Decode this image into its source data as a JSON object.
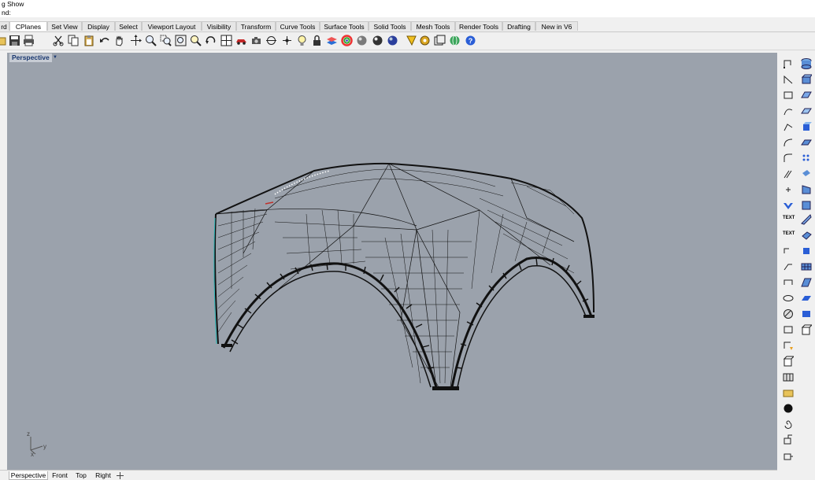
{
  "command_lines": {
    "line1": "g Show",
    "line2": "nd:"
  },
  "tabs": [
    {
      "label": "rd"
    },
    {
      "label": "CPlanes"
    },
    {
      "label": "Set View"
    },
    {
      "label": "Display"
    },
    {
      "label": "Select"
    },
    {
      "label": "Viewport Layout"
    },
    {
      "label": "Visibility"
    },
    {
      "label": "Transform"
    },
    {
      "label": "Curve Tools"
    },
    {
      "label": "Surface Tools"
    },
    {
      "label": "Solid Tools"
    },
    {
      "label": "Mesh Tools"
    },
    {
      "label": "Render Tools"
    },
    {
      "label": "Drafting"
    },
    {
      "label": "New in V6"
    }
  ],
  "toolbar_icons": [
    "open-file-icon",
    "save-icon",
    "print-icon",
    "cut-icon",
    "copy-icon",
    "paste-icon",
    "undo-icon",
    "pan-hand-icon",
    "rotate-view-icon",
    "zoom-dynamic-icon",
    "zoom-window-icon",
    "zoom-extents-icon",
    "zoom-selected-icon",
    "undo-view-icon",
    "four-viewports-icon",
    "car-icon",
    "camera-icon",
    "cplane-icon",
    "point-icon",
    "light-icon",
    "lock-icon",
    "layer-icon",
    "color-wheel-icon",
    "shaded-sphere-icon",
    "rendered-sphere-icon",
    "ghosted-sphere-icon",
    "sphere-blue-icon",
    "render-icon",
    "render-settings-icon",
    "filter-icon",
    "globe-icon",
    "help-icon"
  ],
  "viewport": {
    "label": "Perspective",
    "background": "#9ba2ac",
    "axes": {
      "z": "z",
      "y": "y",
      "x": "x"
    }
  },
  "right_panel": {
    "text1": "TEXT",
    "text2": "TEXT"
  },
  "bottom_tabs": [
    {
      "label": "Perspective",
      "active": true
    },
    {
      "label": "Front",
      "active": false
    },
    {
      "label": "Top",
      "active": false
    },
    {
      "label": "Right",
      "active": false
    }
  ],
  "colors": {
    "viewport_bg": "#9ba2ac",
    "wire": "#111111",
    "active_label": "#1a3870"
  }
}
